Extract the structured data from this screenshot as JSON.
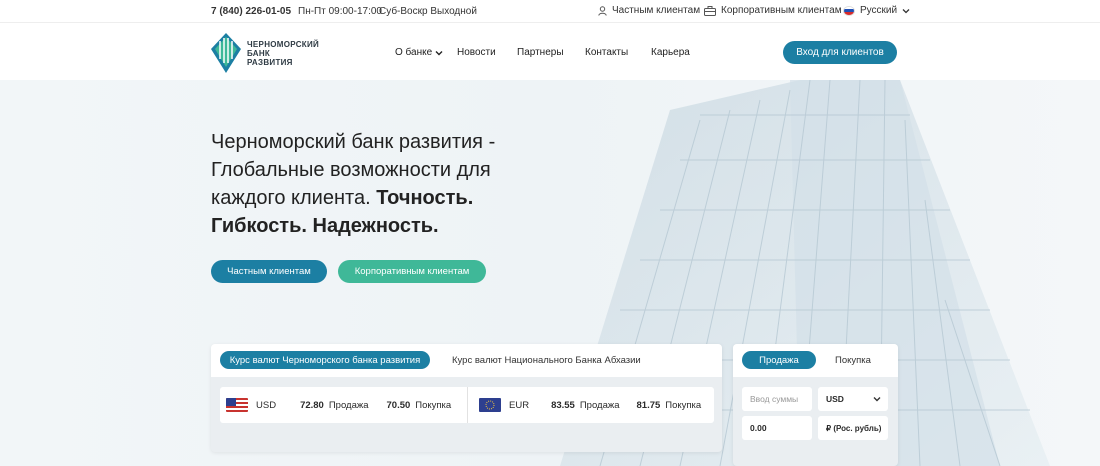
{
  "topbar": {
    "phone": "7 (840) 226-01-05",
    "hours": "Пн-Пт 09:00-17:00",
    "weekend": "Суб-Воскр Выходной",
    "private_link": "Частным клиентам",
    "corporate_link": "Корпоративным клиентам",
    "language": "Русский"
  },
  "header": {
    "logo_line1": "ЧЕРНОМОРСКИЙ",
    "logo_line2": "БАНК",
    "logo_line3": "РАЗВИТИЯ",
    "nav": [
      "О банке",
      "Новости",
      "Партнеры",
      "Контакты",
      "Карьера"
    ],
    "login_button": "Вход для клиентов"
  },
  "hero": {
    "title_regular": "Черноморский банк развития - Глобальные возможности для каждого клиента.",
    "title_bold": "Точность. Гибкость. Надежность.",
    "btn_private": "Частным клиентам",
    "btn_corporate": "Корпоративным клиентам"
  },
  "rates": {
    "tab_active": "Курс валют Черноморского банка развития",
    "tab_other": "Курс валют Национального Банка Абхазии",
    "items": [
      {
        "currency": "USD",
        "sell": "72.80",
        "sell_label": "Продажа",
        "buy": "70.50",
        "buy_label": "Покупка"
      },
      {
        "currency": "EUR",
        "sell": "83.55",
        "sell_label": "Продажа",
        "buy": "81.75",
        "buy_label": "Покупка"
      }
    ]
  },
  "converter": {
    "tab_sell": "Продажа",
    "tab_buy": "Покупка",
    "amount_placeholder": "Ввод суммы",
    "currency_selected": "USD",
    "result_value": "0.00",
    "result_currency": "₽ (Рос. рубль)"
  },
  "colors": {
    "primary": "#1c7fa3",
    "accent_green": "#3fb898"
  }
}
